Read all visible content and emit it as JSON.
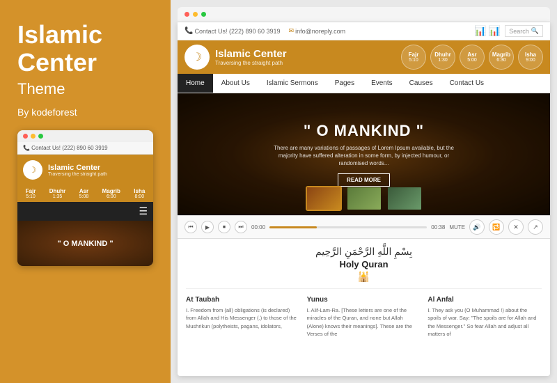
{
  "left": {
    "title": "Islamic\nCenter",
    "subtitle": "Theme",
    "by": "By kodeforest"
  },
  "browser": {
    "dots": [
      "red",
      "yellow",
      "green"
    ]
  },
  "topbar": {
    "contact": "Contact Us! (222) 890 60 3919",
    "email": "info@noreply.com",
    "search_placeholder": "Search"
  },
  "header": {
    "logo_symbol": "☽",
    "site_name": "Islamic Center",
    "tagline": "Traversing the straight path",
    "prayer_times": [
      {
        "name": "Fajr",
        "time": "5:10"
      },
      {
        "name": "Dhuhr",
        "time": "1:30"
      },
      {
        "name": "Asr",
        "time": "5:00"
      },
      {
        "name": "Magrib",
        "time": "6:30"
      },
      {
        "name": "Isha",
        "time": "9:00"
      }
    ]
  },
  "nav": {
    "items": [
      "Home",
      "About Us",
      "Islamic Sermons",
      "Pages",
      "Events",
      "Causes",
      "Contact Us"
    ],
    "active": "Home"
  },
  "hero": {
    "title": "\" O MANKIND \"",
    "description": "There are many variations of passages of Lorem Ipsum available, but the majority have suffered alteration in some form, by injected humour, or randomised words...",
    "cta": "READ MORE"
  },
  "audio": {
    "time_start": "00:00",
    "time_end": "00:38",
    "mute_label": "MUTE"
  },
  "quran": {
    "arabic": "بِسْمِ اللَّهِ الرَّحْمَنِ الرَّحِيم",
    "title": "Holy Quran",
    "icon": "🕌"
  },
  "columns": [
    {
      "title": "At Taubah",
      "text": "I. Freedom from (all) obligations (is declared) from Allah and His Messenger (.) to those of the Mushrikun (polytheists, pagans, idolators,"
    },
    {
      "title": "Yunus",
      "text": "I. Alif-Lam-Ra. [These letters are one of the miracles of the Quran, and none but Allah (Alone) knows their meanings]. These are the Verses of the"
    },
    {
      "title": "Al Anfal",
      "text": "I. They ask you (O Muhammad !) about the spoils of war. Say: \"The spoils are for Allah and the Messenger.\" So fear Allah and adjust all matters of"
    }
  ]
}
